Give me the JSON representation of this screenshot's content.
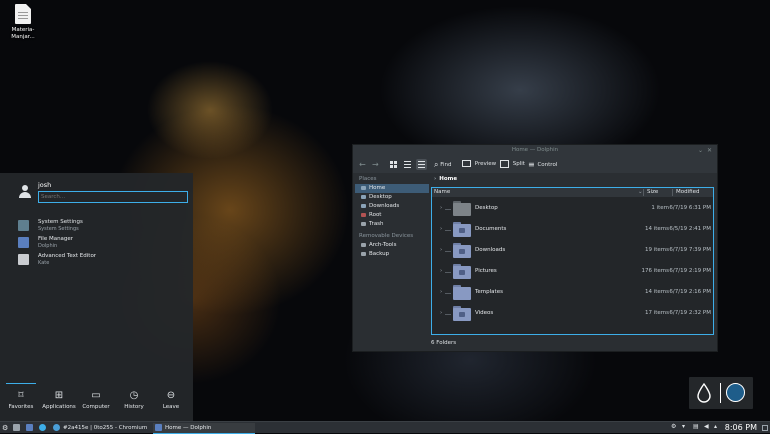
{
  "desktop": {
    "icons": [
      {
        "label": "Materia-Manjar..."
      }
    ]
  },
  "dolphin": {
    "title": "Home — Dolphin",
    "toolbar": {
      "find": "Find",
      "preview": "Preview",
      "split": "Split",
      "control": "Control"
    },
    "places_header": "Places",
    "places": [
      {
        "label": "Home",
        "active": true
      },
      {
        "label": "Desktop"
      },
      {
        "label": "Downloads"
      },
      {
        "label": "Root"
      },
      {
        "label": "Trash"
      }
    ],
    "removable_header": "Removable Devices",
    "removable": [
      {
        "label": "Arch-Tools"
      },
      {
        "label": "Backup"
      }
    ],
    "breadcrumb": "Home",
    "columns": {
      "name": "Name",
      "size": "Size",
      "modified": "Modified"
    },
    "rows": [
      {
        "name": "Desktop",
        "size": "1 item",
        "modified": "6/7/19 6:31 PM",
        "icon": "desktop-folder-icon"
      },
      {
        "name": "Documents",
        "size": "14 items",
        "modified": "6/5/19 2:41 PM",
        "icon": "documents-folder-icon"
      },
      {
        "name": "Downloads",
        "size": "19 items",
        "modified": "6/7/19 7:39 PM",
        "icon": "downloads-folder-icon"
      },
      {
        "name": "Pictures",
        "size": "176 items",
        "modified": "6/7/19 2:19 PM",
        "icon": "pictures-folder-icon"
      },
      {
        "name": "Templates",
        "size": "14 items",
        "modified": "6/7/19 2:16 PM",
        "icon": "templates-folder-icon"
      },
      {
        "name": "Videos",
        "size": "17 items",
        "modified": "6/7/19 2:32 PM",
        "icon": "videos-folder-icon"
      }
    ],
    "status": "6 Folders"
  },
  "launcher": {
    "username": "josh",
    "search_placeholder": "Search...",
    "apps": [
      {
        "title": "System Settings",
        "subtitle": "System Settings",
        "color": "#5f7f8f"
      },
      {
        "title": "File Manager",
        "subtitle": "Dolphin",
        "color": "#5a7fbf"
      },
      {
        "title": "Advanced Text Editor",
        "subtitle": "Kate",
        "color": "#c9ccd0"
      }
    ],
    "tabs": [
      {
        "label": "Favorites",
        "icon": "bookmark-icon",
        "active": true
      },
      {
        "label": "Applications",
        "icon": "applications-grid-icon"
      },
      {
        "label": "Computer",
        "icon": "computer-icon"
      },
      {
        "label": "History",
        "icon": "history-clock-icon"
      },
      {
        "label": "Leave",
        "icon": "leave-icon"
      }
    ]
  },
  "taskbar": {
    "tasks": [
      {
        "label": "#2a415e | 0to255 - Chromium",
        "icon": "chromium-icon"
      },
      {
        "label": "Home — Dolphin",
        "icon": "dolphin-icon",
        "active": true
      }
    ],
    "clock": "8:06 PM"
  },
  "colors": {
    "accent": "#3daee9",
    "window": "#2a2e32",
    "panel": "#31363b"
  }
}
